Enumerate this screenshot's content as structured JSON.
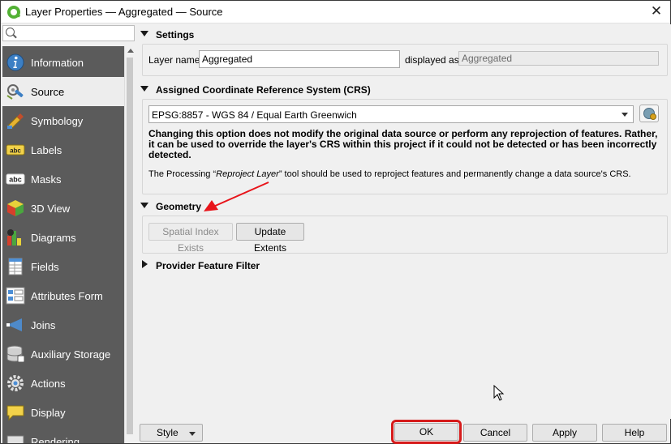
{
  "window": {
    "title": "Layer Properties — Aggregated — Source",
    "close_glyph": "✕",
    "app_icon": "qgis-icon"
  },
  "sidebar": {
    "search_placeholder": "",
    "items": [
      {
        "label": "Information",
        "icon": "information-icon"
      },
      {
        "label": "Source",
        "icon": "source-icon",
        "active": true
      },
      {
        "label": "Symbology",
        "icon": "symbology-icon"
      },
      {
        "label": "Labels",
        "icon": "labels-icon"
      },
      {
        "label": "Masks",
        "icon": "masks-icon"
      },
      {
        "label": "3D View",
        "icon": "3d-view-icon"
      },
      {
        "label": "Diagrams",
        "icon": "diagrams-icon"
      },
      {
        "label": "Fields",
        "icon": "fields-icon"
      },
      {
        "label": "Attributes Form",
        "icon": "attributes-form-icon"
      },
      {
        "label": "Joins",
        "icon": "joins-icon"
      },
      {
        "label": "Auxiliary Storage",
        "icon": "auxiliary-storage-icon"
      },
      {
        "label": "Actions",
        "icon": "actions-icon"
      },
      {
        "label": "Display",
        "icon": "display-icon"
      },
      {
        "label": "Rendering",
        "icon": "rendering-icon"
      }
    ]
  },
  "settings": {
    "header": "Settings",
    "layer_name_label": "Layer name",
    "layer_name_value": "Aggregated",
    "displayed_as_label": "displayed as",
    "displayed_as_value": "Aggregated"
  },
  "crs": {
    "header": "Assigned Coordinate Reference System (CRS)",
    "selected": "EPSG:8857 - WGS 84 / Equal Earth Greenwich",
    "warning_line1": "Changing this option does not modify the original data source or perform any reprojection of features. Rather,",
    "warning_line2": "it can be used to override the layer's CRS within this project if it could not be detected or has been incorrectly",
    "warning_line3": "detected.",
    "note_prefix": "The Processing “",
    "note_tool": "Reproject Layer",
    "note_suffix": "” tool should be used to reproject features and permanently change a data source's CRS."
  },
  "geometry": {
    "header": "Geometry",
    "spatial_index_label": "Spatial Index Exists",
    "update_extents_label": "Update Extents"
  },
  "provider_filter": {
    "header": "Provider Feature Filter"
  },
  "footer": {
    "style_label": "Style",
    "ok_label": "OK",
    "cancel_label": "Cancel",
    "apply_label": "Apply",
    "help_label": "Help"
  },
  "colors": {
    "sidebar_bg": "#5b5b5b",
    "highlight_red": "#d61a1a",
    "annotation_arrow": "#e8141a"
  }
}
